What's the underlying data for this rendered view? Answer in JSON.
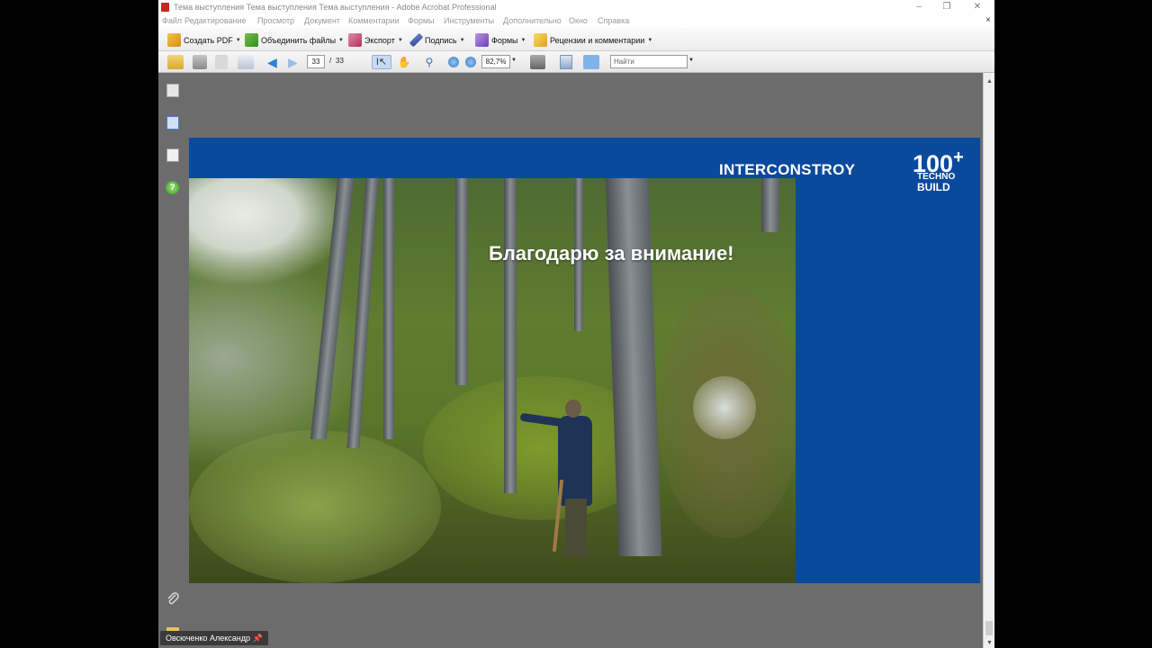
{
  "window": {
    "title": "Тема выступления Тема выступления Тема выступления - Adobe Acrobat Professional",
    "minimize": "–",
    "restore": "❐",
    "close": "✕",
    "doc_close": "×"
  },
  "menu": {
    "items": [
      "Файл",
      "Редактирование",
      "Просмотр",
      "Документ",
      "Комментарии",
      "Формы",
      "Инструменты",
      "Дополнительно",
      "Окно",
      "Справка"
    ]
  },
  "toolbar1": {
    "create_pdf": "Создать PDF",
    "combine": "Объединить файлы",
    "export": "Экспорт",
    "sign": "Подпись",
    "forms": "Формы",
    "review": "Рецензии и комментарии"
  },
  "toolbar2": {
    "current_page": "33",
    "page_sep": "/",
    "total_pages": "33",
    "zoom": "82,7%",
    "find_placeholder": "Найти"
  },
  "slide": {
    "brand": "INTERCONSTROY",
    "logo_number": "100",
    "logo_plus": "+",
    "logo_line1": "TECHNO",
    "logo_line2": "BUILD",
    "heading": "Благодарю за внимание!"
  },
  "user": {
    "name": "Овсюченко Александр",
    "pin_icon": "pin-icon"
  },
  "colors": {
    "slide_blue": "#0a4a9c",
    "workspace_gray": "#6c6c6c"
  }
}
